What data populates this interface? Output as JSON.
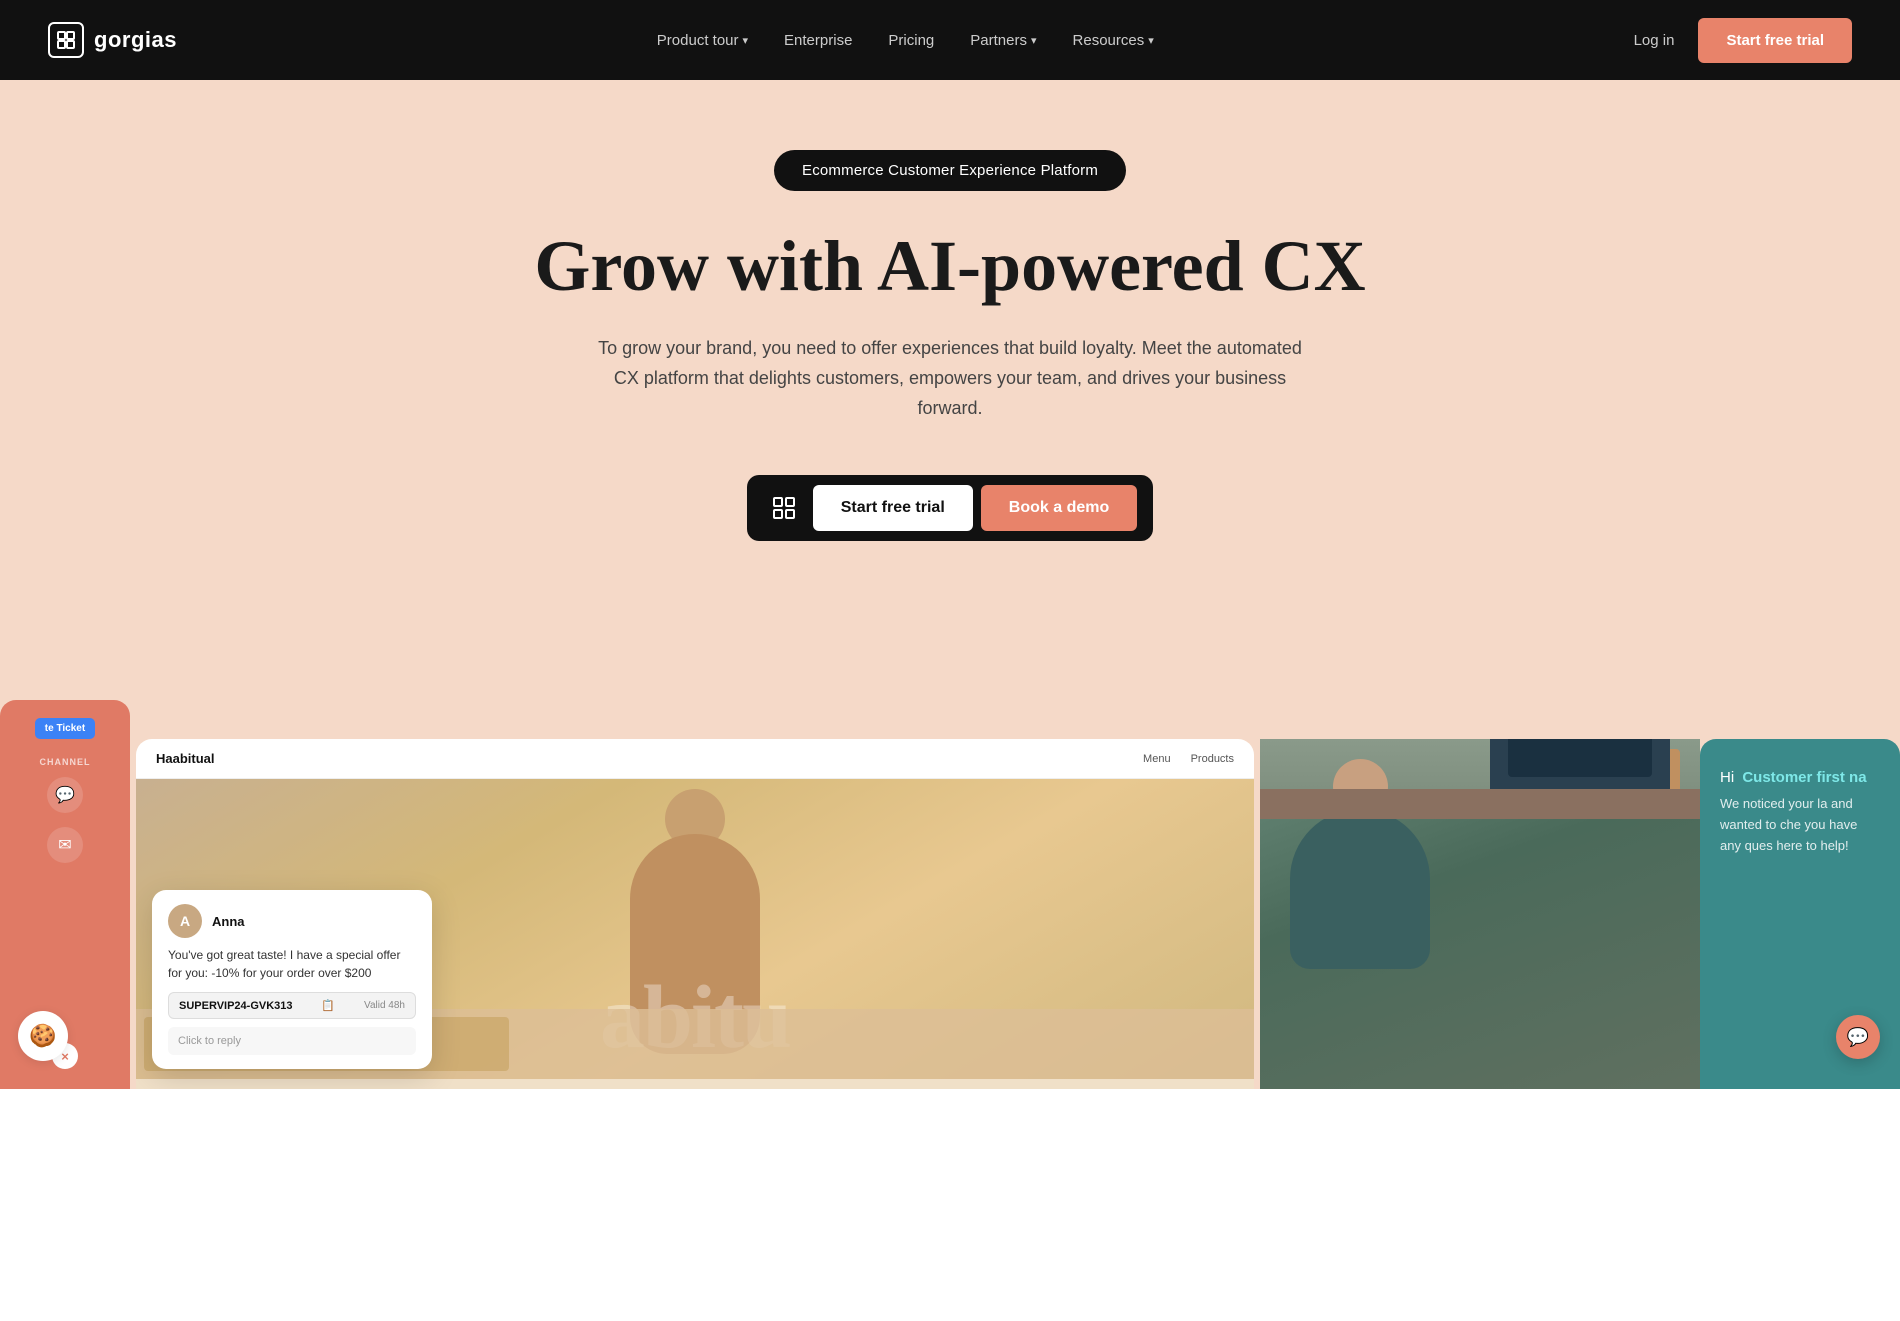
{
  "nav": {
    "logo_text": "gorgias",
    "links": [
      {
        "label": "Product tour",
        "has_dropdown": true
      },
      {
        "label": "Enterprise",
        "has_dropdown": false
      },
      {
        "label": "Pricing",
        "has_dropdown": false
      },
      {
        "label": "Partners",
        "has_dropdown": true
      },
      {
        "label": "Resources",
        "has_dropdown": true
      }
    ],
    "login_label": "Log in",
    "trial_label": "Start free trial"
  },
  "hero": {
    "badge_text": "Ecommerce Customer Experience Platform",
    "title": "Grow with AI-powered CX",
    "subtitle": "To grow your brand, you need to offer experiences that build loyalty. Meet the automated CX platform that delights customers, empowers your team, and drives your business forward.",
    "cta_trial": "Start free trial",
    "cta_demo": "Book a demo"
  },
  "chat_popup": {
    "agent_name": "Anna",
    "message": "You've got great taste! I have a special offer for you: -10% for your order over $200",
    "promo_code": "SUPERVIP24-GVK313",
    "validity": "Valid 48h",
    "input_placeholder": "Click to reply"
  },
  "site_header": {
    "brand": "Haabitual",
    "nav_items": [
      "Menu",
      "Products"
    ]
  },
  "hero_image_text": "abitu",
  "right_chat": {
    "greeting": "Hi",
    "customer_label": "Customer first na",
    "message": "We noticed your la and wanted to che you have any ques here to help!"
  },
  "left_panel": {
    "ticket_label": "te Ticket",
    "channel_label": "CHANNEL"
  },
  "colors": {
    "nav_bg": "#111111",
    "hero_bg": "#f5d9c8",
    "coral": "#e07a65",
    "teal": "#3a8a8a",
    "blue_btn": "#3b82f6",
    "accent": "#e8836a"
  }
}
